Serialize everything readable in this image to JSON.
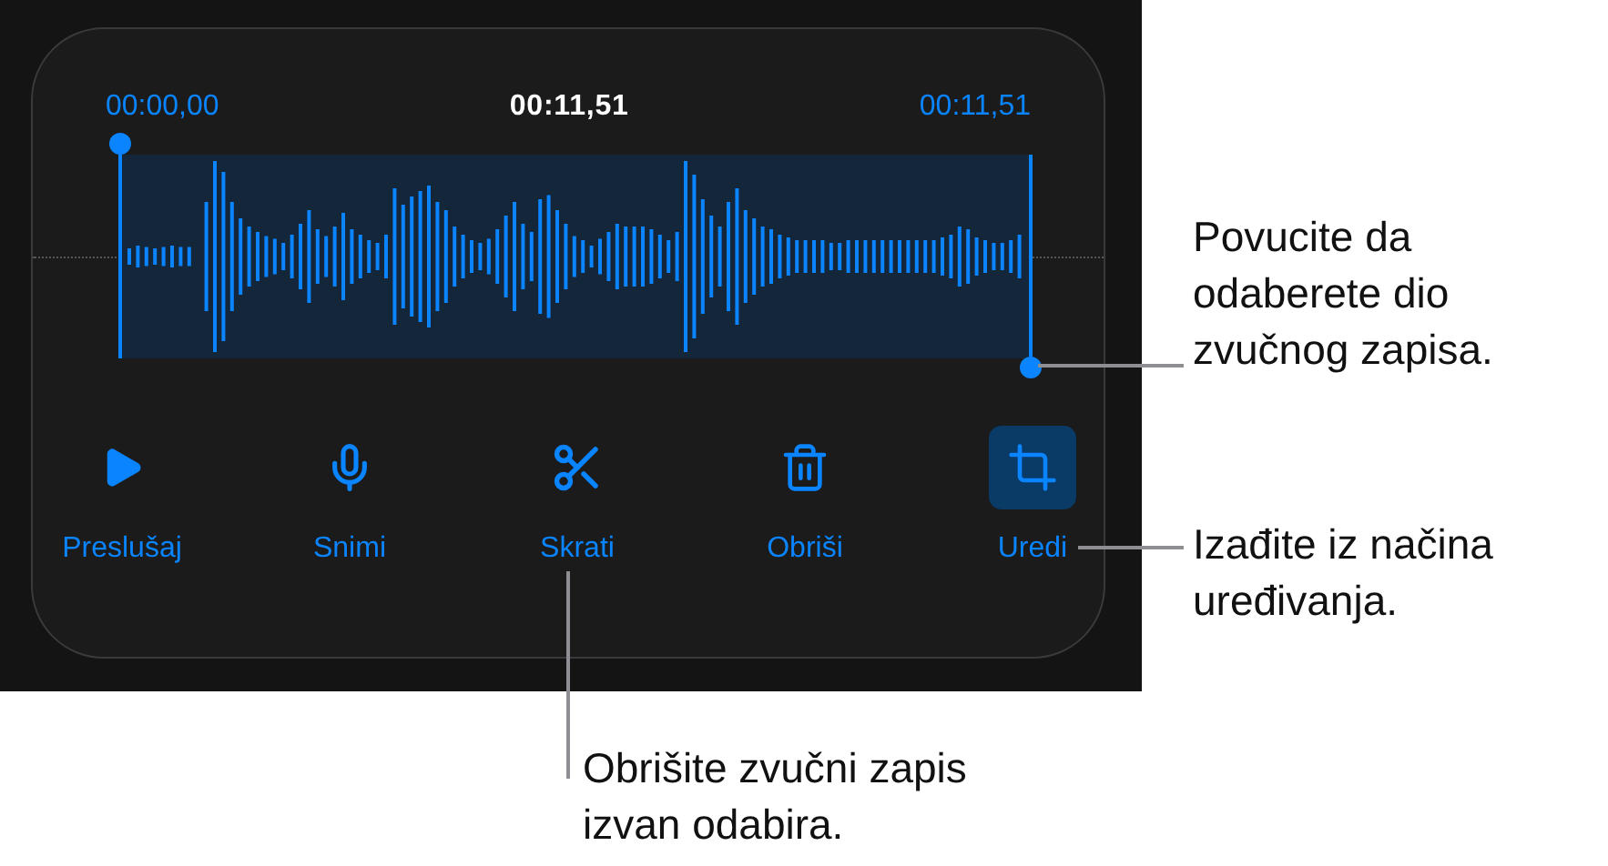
{
  "recording": {
    "start_time": "00:00,00",
    "current_time": "00:11,51",
    "end_time": "00:11,51"
  },
  "buttons": [
    {
      "kind": "play",
      "label": "Preslušaj",
      "selected": false
    },
    {
      "kind": "record",
      "label": "Snimi",
      "selected": false
    },
    {
      "kind": "trim",
      "label": "Skrati",
      "selected": false
    },
    {
      "kind": "delete",
      "label": "Obriši",
      "selected": false
    },
    {
      "kind": "edit",
      "label": "Uredi",
      "selected": true
    }
  ],
  "callouts": [
    {
      "kind": "handle",
      "text": "Povucite da odaberete dio zvučnog zapisa."
    },
    {
      "kind": "edit",
      "text": "Izađite iz načina uređivanja."
    },
    {
      "kind": "trim",
      "text": "Obrišite zvučni zapis izvan odabira."
    }
  ]
}
